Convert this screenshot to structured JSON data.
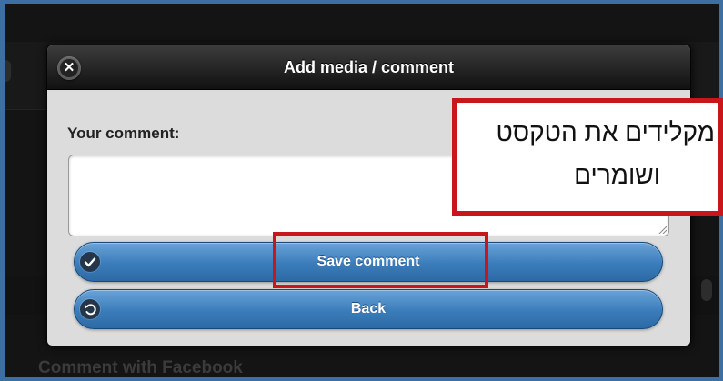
{
  "background": {
    "facebook_label": "Comment with Facebook"
  },
  "dialog": {
    "title": "Add media / comment",
    "close_icon": "close-icon",
    "comment_label": "Your comment:",
    "comment_value": "",
    "save_label": "Save comment",
    "save_icon": "check-icon",
    "back_label": "Back",
    "back_icon": "undo-icon"
  },
  "annotation": {
    "callout_line1": "מקלידים את הטקסט",
    "callout_line2": "ושומרים",
    "highlight_color": "#c8161a"
  },
  "colors": {
    "button_blue": "#3a7cba",
    "header_dark": "#1a1a1a",
    "dialog_bg": "#dcdcdc"
  }
}
